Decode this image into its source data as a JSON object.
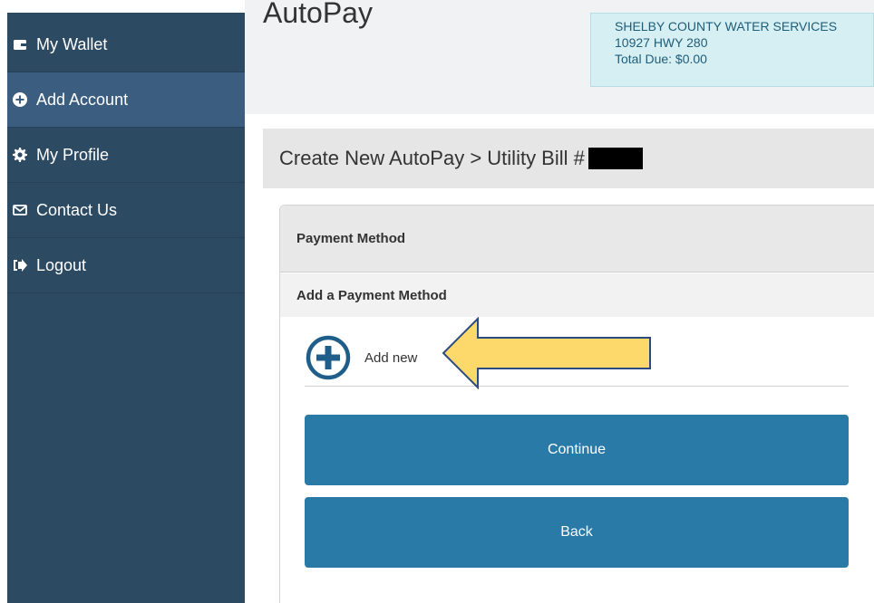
{
  "sidebar": {
    "items": [
      {
        "label": "My Wallet",
        "icon": "wallet-icon",
        "active": false
      },
      {
        "label": "Add Account",
        "icon": "plus-circle-icon",
        "active": true
      },
      {
        "label": "My Profile",
        "icon": "gear-icon",
        "active": false
      },
      {
        "label": "Contact Us",
        "icon": "envelope-icon",
        "active": false
      },
      {
        "label": "Logout",
        "icon": "logout-icon",
        "active": false
      }
    ]
  },
  "page": {
    "title": "AutoPay",
    "breadcrumb": "Create New AutoPay > Utility Bill #"
  },
  "account": {
    "name": "SHELBY COUNTY WATER SERVICES",
    "address": "10927 HWY 280",
    "total_due": "Total Due: $0.00"
  },
  "panel": {
    "heading": "Payment Method",
    "subheading": "Add a Payment Method",
    "add_new_label": "Add new"
  },
  "buttons": {
    "continue": "Continue",
    "back": "Back"
  },
  "colors": {
    "sidebar": "#2d4a63",
    "sidebar_active": "#3b5d80",
    "button": "#2a7aa8",
    "arrow": "#fdd96b",
    "plus_icon": "#1f5e8a"
  }
}
